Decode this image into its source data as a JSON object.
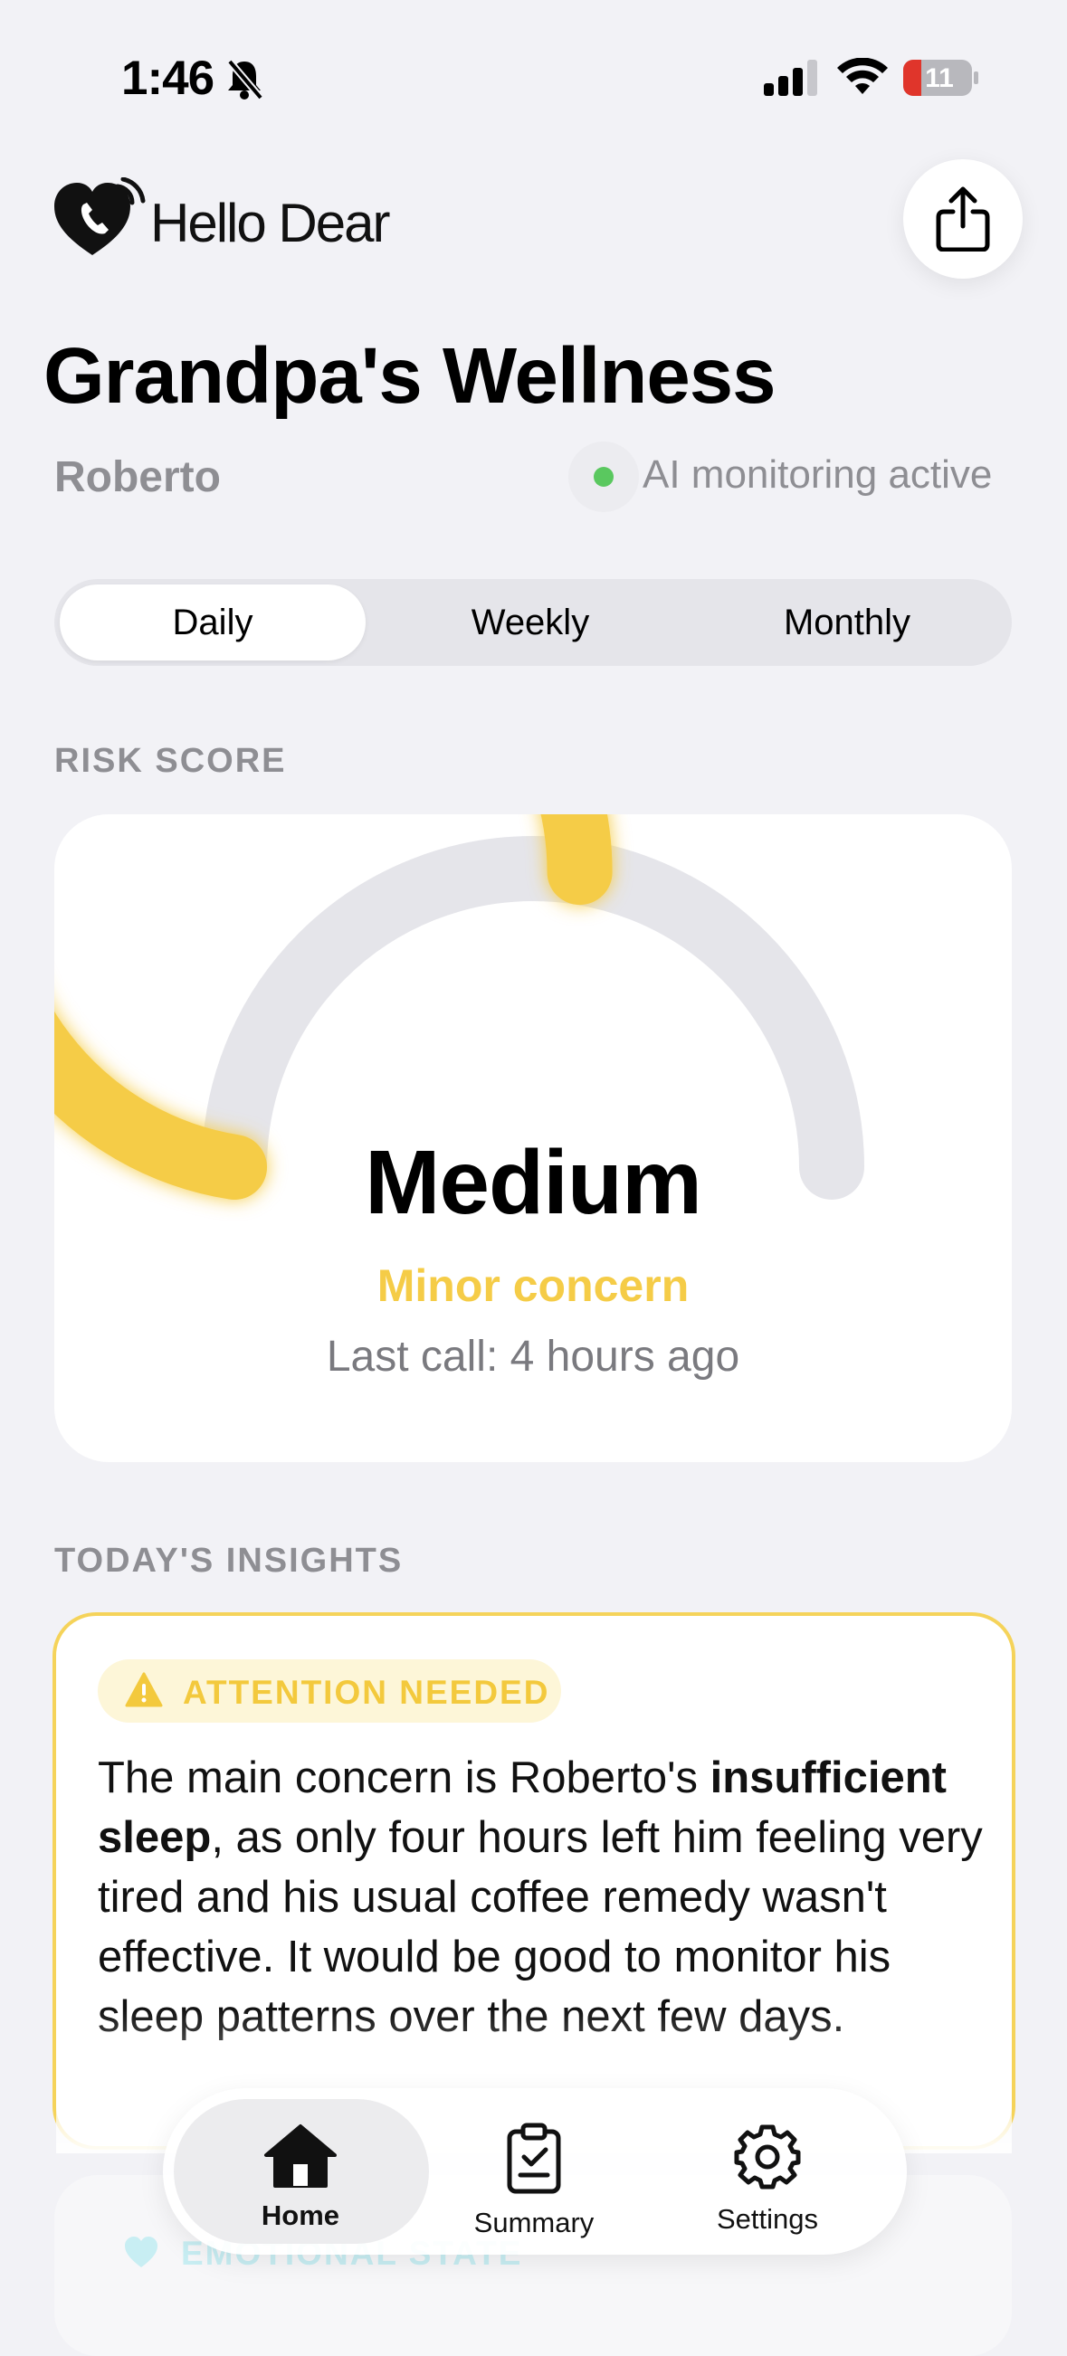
{
  "status_bar": {
    "time": "1:46",
    "battery": "11"
  },
  "header": {
    "app_name": "Hello Dear",
    "title": "Grandpa's Wellness",
    "person_name": "Roberto",
    "monitoring_status": "AI monitoring active"
  },
  "segments": [
    "Daily",
    "Weekly",
    "Monthly"
  ],
  "risk": {
    "section_label": "RISK SCORE",
    "level": "Medium",
    "descriptor": "Minor concern",
    "last_call": "Last call: 4 hours ago",
    "gauge_fraction": 0.55,
    "accent_color": "#f5cc47"
  },
  "insights": {
    "section_label": "TODAY'S INSIGHTS",
    "badge": "ATTENTION NEEDED",
    "text_before": "The main concern is Roberto's ",
    "text_bold": "insufficient sleep",
    "text_after": ", as only four hours left him feeling very tired and his usual coffee remedy wasn't effective. It would be good to monitor his sleep patterns over the next few days."
  },
  "next_card": {
    "label": "EMOTIONAL STATE"
  },
  "tabbar": {
    "home": "Home",
    "summary": "Summary",
    "settings": "Settings"
  }
}
